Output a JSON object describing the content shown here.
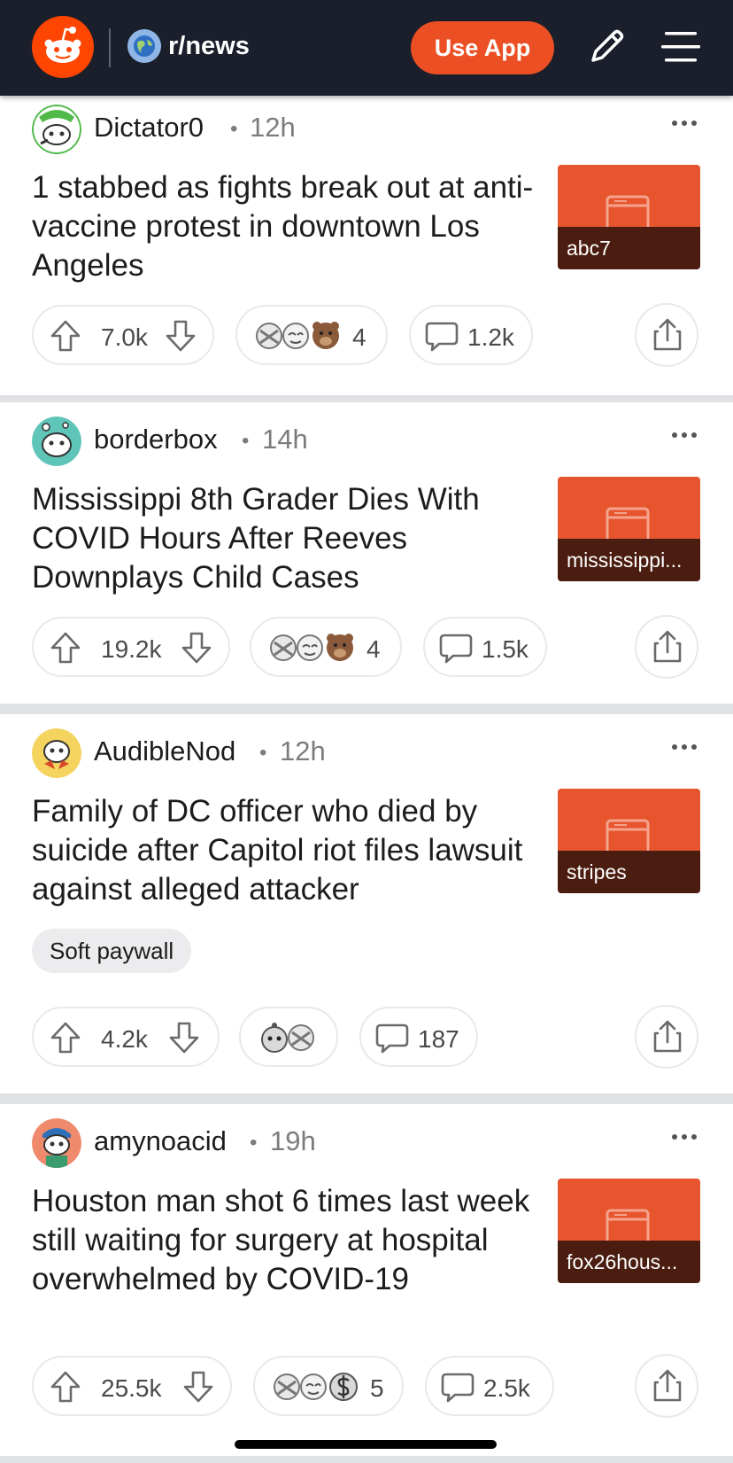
{
  "header": {
    "subreddit": "r/news",
    "use_app_label": "Use App",
    "logo_icon": "reddit-snoo-icon",
    "edit_icon": "pencil-icon",
    "menu_icon": "hamburger-menu-icon",
    "accent_color": "#ec4f24"
  },
  "posts": [
    {
      "author": "Dictator0",
      "separator": "•",
      "time": "12h",
      "title": "1 stabbed as fights break out at anti-vaccine protest in downtown Los Angeles",
      "thumbnail_caption": "abc7",
      "upvotes": "7.0k",
      "award_count": "4",
      "comments": "1.2k"
    },
    {
      "author": "borderbox",
      "separator": "•",
      "time": "14h",
      "title": "Mississippi 8th Grader Dies With COVID Hours After Reeves Downplays Child Cases",
      "thumbnail_caption": "mississippi...",
      "upvotes": "19.2k",
      "award_count": "4",
      "comments": "1.5k"
    },
    {
      "author": "AudibleNod",
      "separator": "•",
      "time": "12h",
      "title": "Family of DC officer who died by suicide after Capitol riot files lawsuit against alleged attacker",
      "flair": "Soft paywall",
      "thumbnail_caption": "stripes",
      "upvotes": "4.2k",
      "award_count": "",
      "comments": "187"
    },
    {
      "author": "amynoacid",
      "separator": "•",
      "time": "19h",
      "title": "Houston man shot 6 times last week still waiting for surgery at hospital overwhelmed by COVID-19",
      "thumbnail_caption": "fox26hous...",
      "upvotes": "25.5k",
      "award_count": "5",
      "comments": "2.5k"
    }
  ]
}
